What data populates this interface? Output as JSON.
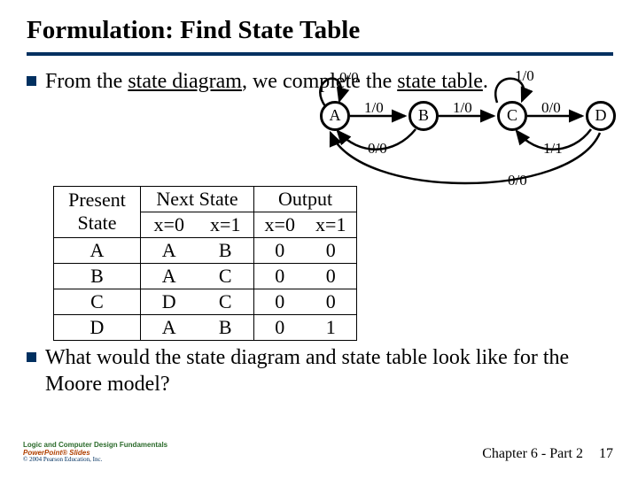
{
  "title": "Formulation: Find State Table",
  "bullet1": {
    "prefix": "From the ",
    "u1": "state diagram",
    "mid": ", we complete the ",
    "u2": "state table",
    "suffix": "."
  },
  "diagram": {
    "states": {
      "A": "A",
      "B": "B",
      "C": "C",
      "D": "D"
    },
    "labels": {
      "loopA": "0/0",
      "loopC": "1/0",
      "AB": "1/0",
      "BC": "1/0",
      "CD": "0/0",
      "BA_low": "0/0",
      "DC_low": "1/1",
      "DA_low": "0/0"
    }
  },
  "table": {
    "h_present": "Present",
    "h_state": "State",
    "h_next": "Next State",
    "h_output": "Output",
    "h_x0": "x=0",
    "h_x1": "x=1",
    "rows": [
      {
        "s": "A",
        "n0": "A",
        "n1": "B",
        "o0": "0",
        "o1": "0"
      },
      {
        "s": "B",
        "n0": "A",
        "n1": "C",
        "o0": "0",
        "o1": "0"
      },
      {
        "s": "C",
        "n0": "D",
        "n1": "C",
        "o0": "0",
        "o1": "0"
      },
      {
        "s": "D",
        "n0": "A",
        "n1": "B",
        "o0": "0",
        "o1": "1"
      }
    ]
  },
  "bullet2": "What would the state diagram and state table look like for the Moore model?",
  "footer": {
    "line1": "Logic and Computer Design Fundamentals",
    "line2": "PowerPoint® Slides",
    "line3": "© 2004 Pearson Education, Inc.",
    "chapter": "Chapter 6 - Part 2",
    "page": "17"
  }
}
